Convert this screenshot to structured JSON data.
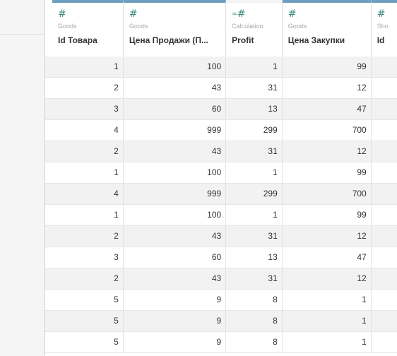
{
  "columns": [
    {
      "type_icon": "#",
      "source": "Goods",
      "name": "Id Товара"
    },
    {
      "type_icon": "#",
      "source": "Goods",
      "name": "Цена Продажи (П..."
    },
    {
      "type_icon": "=#",
      "source": "Calculation",
      "name": "Profit"
    },
    {
      "type_icon": "#",
      "source": "Goods",
      "name": "Цена Закупки"
    },
    {
      "type_icon": "#",
      "source": "Sho",
      "name": "Id"
    }
  ],
  "rows": [
    [
      "1",
      "100",
      "1",
      "99",
      ""
    ],
    [
      "2",
      "43",
      "31",
      "12",
      ""
    ],
    [
      "3",
      "60",
      "13",
      "47",
      ""
    ],
    [
      "4",
      "999",
      "299",
      "700",
      ""
    ],
    [
      "2",
      "43",
      "31",
      "12",
      ""
    ],
    [
      "1",
      "100",
      "1",
      "99",
      ""
    ],
    [
      "4",
      "999",
      "299",
      "700",
      ""
    ],
    [
      "1",
      "100",
      "1",
      "99",
      ""
    ],
    [
      "2",
      "43",
      "31",
      "12",
      ""
    ],
    [
      "3",
      "60",
      "13",
      "47",
      ""
    ],
    [
      "2",
      "43",
      "31",
      "12",
      ""
    ],
    [
      "5",
      "9",
      "8",
      "1",
      ""
    ],
    [
      "5",
      "9",
      "8",
      "1",
      ""
    ],
    [
      "5",
      "9",
      "8",
      "1",
      ""
    ]
  ],
  "colors": {
    "header_accent": "#6f9fbf",
    "type_icon": "#3d8b7d",
    "row_alt": "#f2f2f2"
  }
}
